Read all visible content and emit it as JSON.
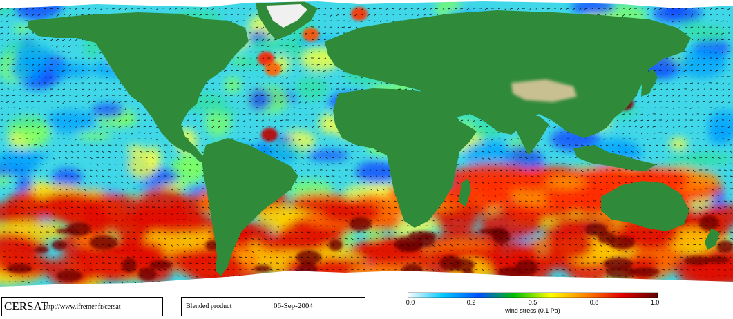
{
  "logo": "CERSAT",
  "url": "http://www.ifremer.fr/cersat",
  "product": "Blended product",
  "date": "06-Sep-2004",
  "colorbar": {
    "title": "wind stress (0.1 Pa)",
    "ticks": [
      "0.0",
      "0.2",
      "0.5",
      "0.8",
      "1.0"
    ],
    "min": 0.0,
    "max": 1.0,
    "colors": [
      "#ffffff",
      "#00c8ff",
      "#0050ff",
      "#00c000",
      "#ffff00",
      "#ff8000",
      "#e00000",
      "#600000"
    ]
  },
  "palette": {
    "land": "#2f8a3a",
    "land_high": "#d8d0a0",
    "ice": "#ffffff",
    "arrow": "#000000"
  }
}
